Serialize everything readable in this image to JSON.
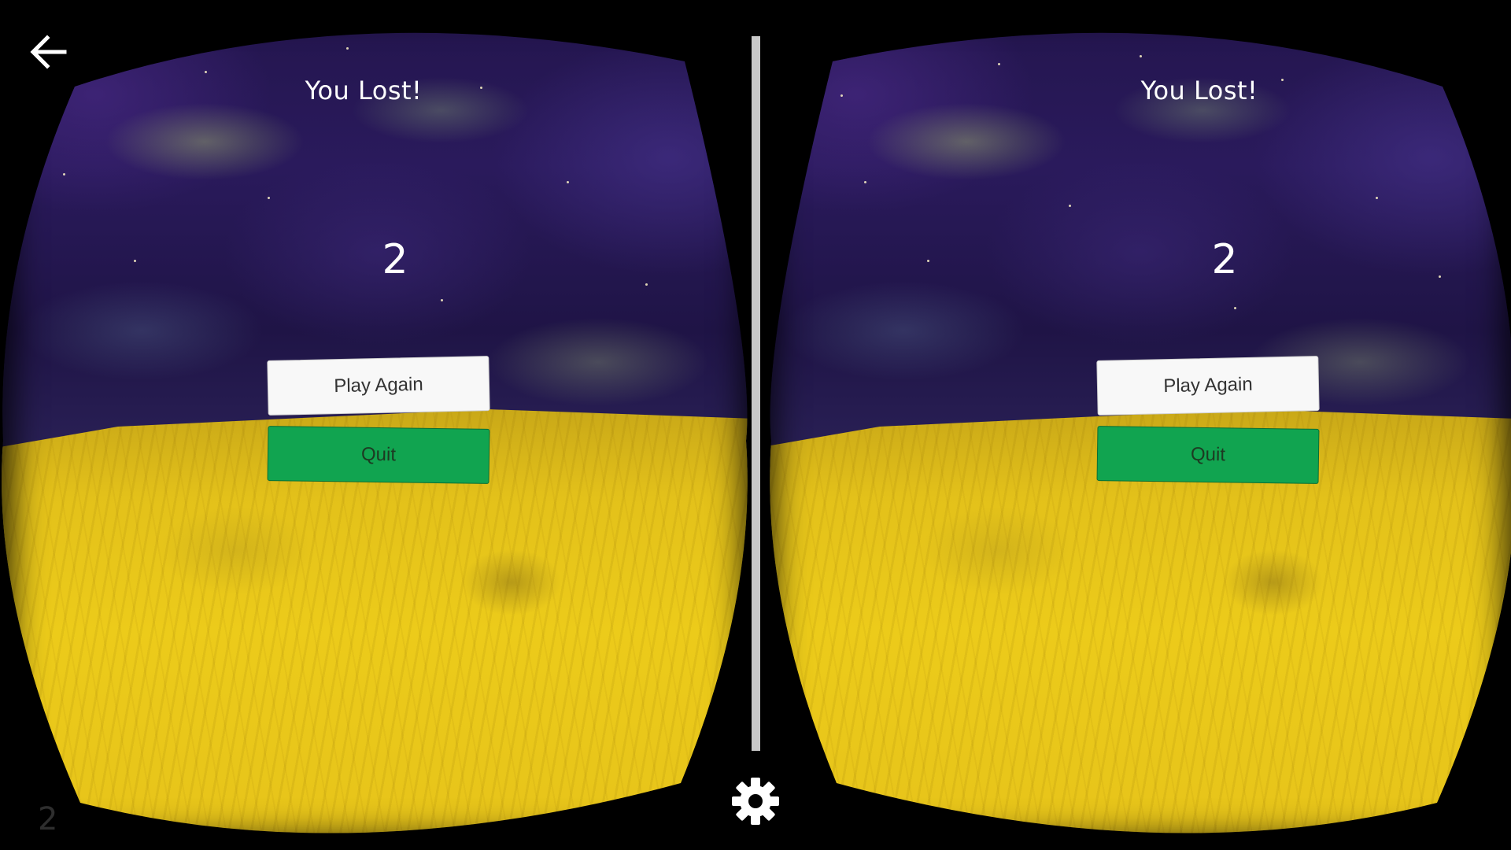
{
  "game": {
    "title": "You Lost!",
    "score": "2",
    "play_again_label": "Play Again",
    "quit_label": "Quit"
  },
  "overlay": {
    "back_icon": "back-arrow-icon",
    "settings_icon": "gear-icon",
    "corner_number": "2"
  },
  "colors": {
    "quit_button": "#11a450",
    "play_again_button": "#f8f8f8",
    "ground": "#eccb1a",
    "sky": "#2a1a5c"
  }
}
